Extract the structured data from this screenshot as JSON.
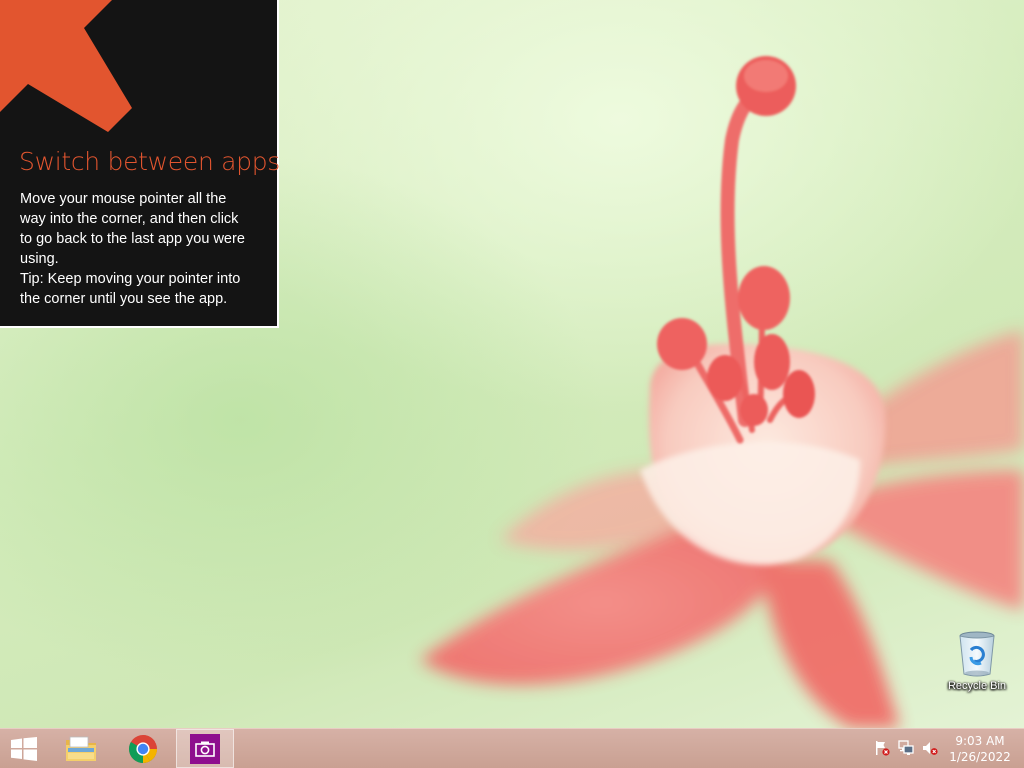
{
  "tip": {
    "title": "Switch between apps",
    "lines": [
      "Move your mouse pointer all the",
      "way into the corner, and then click",
      "to go back to the last app you were",
      "using.",
      "Tip: Keep moving your pointer into",
      "the corner until you see the app."
    ],
    "accent_color": "#E2552F"
  },
  "desktop": {
    "icons": [
      {
        "label": "Recycle Bin",
        "icon": "recycle-bin-icon"
      }
    ]
  },
  "taskbar": {
    "start_icon": "windows-logo-icon",
    "pinned": [
      {
        "name": "File Explorer",
        "icon": "file-explorer-icon"
      },
      {
        "name": "Google Chrome",
        "icon": "chrome-icon"
      },
      {
        "name": "Camera",
        "icon": "camera-icon",
        "active": true,
        "color": "#8E0E8E"
      }
    ],
    "tray": {
      "icons": [
        "action-center-flag-icon",
        "network-icon",
        "volume-muted-icon"
      ],
      "time": "9:03 AM",
      "date": "1/26/2022"
    }
  }
}
